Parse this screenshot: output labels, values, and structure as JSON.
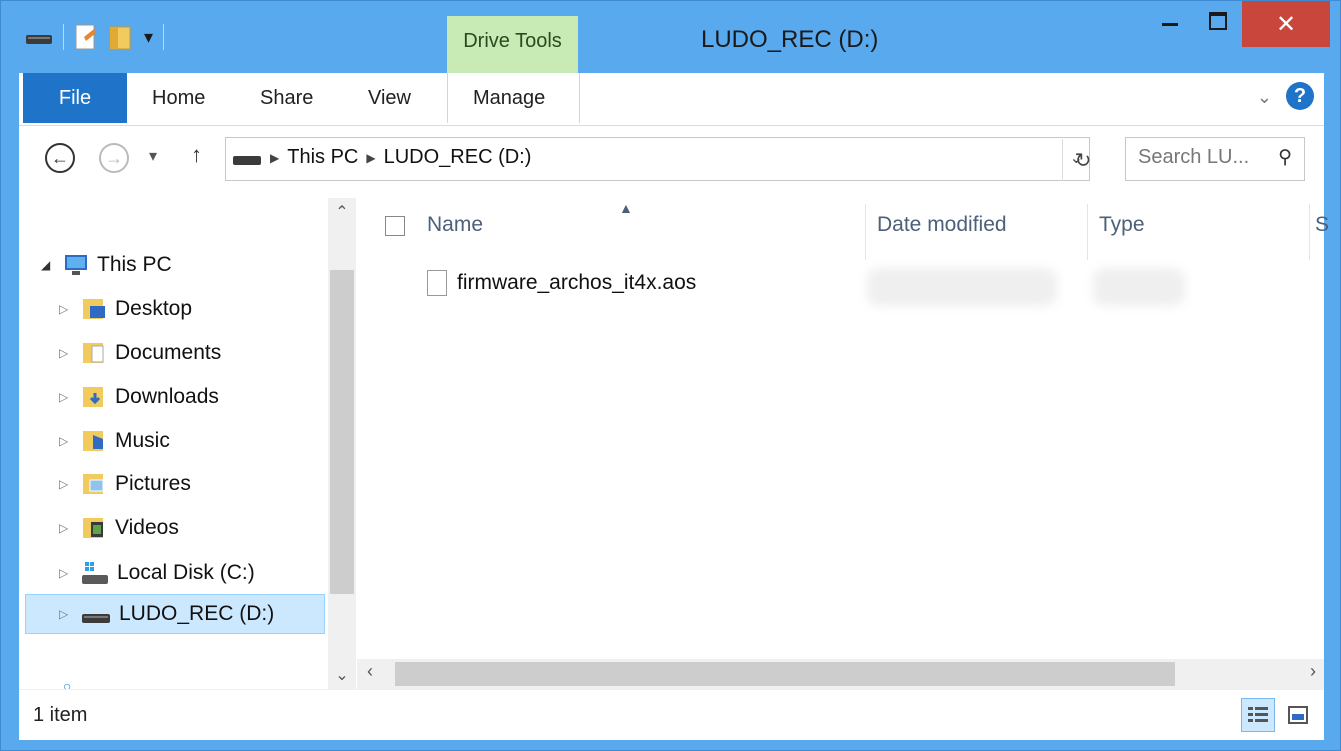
{
  "window": {
    "title": "LUDO_REC (D:)"
  },
  "ribbon": {
    "contextual_tab": "Drive Tools",
    "tabs": {
      "file": "File",
      "home": "Home",
      "share": "Share",
      "view": "View",
      "manage": "Manage"
    }
  },
  "addressbar": {
    "crumbs": [
      "This PC",
      "LUDO_REC (D:)"
    ],
    "search_placeholder": "Search LU..."
  },
  "navpane": {
    "root": "This PC",
    "items": [
      "Desktop",
      "Documents",
      "Downloads",
      "Music",
      "Pictures",
      "Videos",
      "Local Disk (C:)",
      "LUDO_REC (D:)"
    ],
    "selected": "LUDO_REC (D:)"
  },
  "filelist": {
    "columns": [
      "Name",
      "Date modified",
      "Type",
      "S"
    ],
    "files": [
      {
        "name": "firmware_archos_it4x.aos"
      }
    ]
  },
  "status": {
    "count": "1 item"
  },
  "colors": {
    "accent": "#1f73c9",
    "titlebar": "#58a9ee",
    "close": "#c9463d",
    "contextual": "#c8eab4"
  }
}
